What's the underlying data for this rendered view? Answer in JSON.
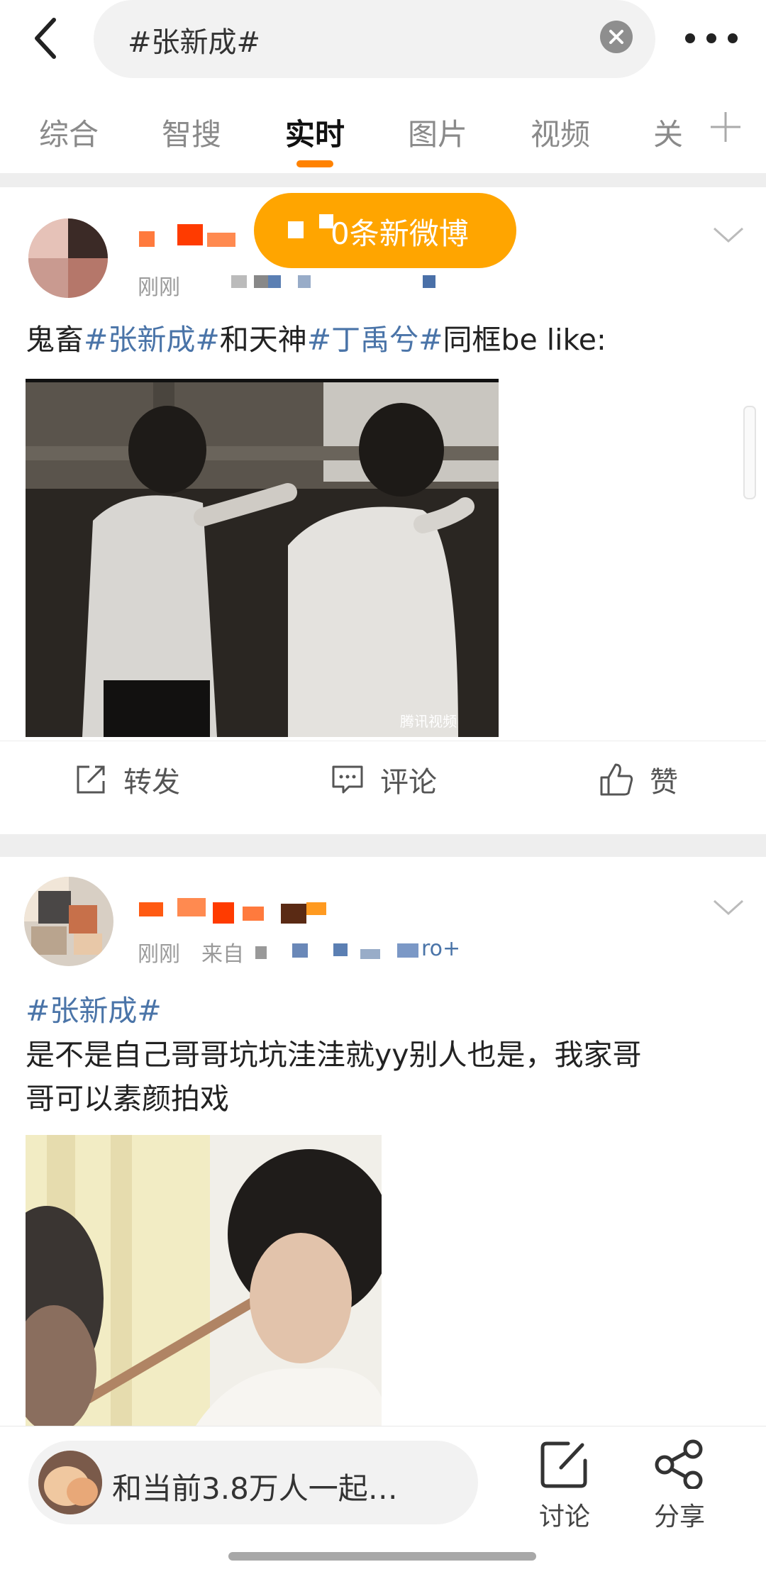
{
  "search": {
    "query": "#张新成#"
  },
  "tabs": [
    {
      "label": "综合",
      "active": false
    },
    {
      "label": "智搜",
      "active": false
    },
    {
      "label": "实时",
      "active": true
    },
    {
      "label": "图片",
      "active": false
    },
    {
      "label": "视频",
      "active": false
    },
    {
      "label": "关",
      "active": false
    }
  ],
  "toast": {
    "text": "0条新微博"
  },
  "post1": {
    "time": "刚刚",
    "text_pre": "鬼畜",
    "topic1": "#张新成#",
    "text_mid": "和天神",
    "topic2": "#丁禹兮#",
    "text_post": "同框be like:",
    "image_watermark": "腾讯视频"
  },
  "actions": {
    "repost": "转发",
    "comment": "评论",
    "like": "赞"
  },
  "post2": {
    "time": "刚刚",
    "source_prefix": "来自",
    "source_suffix": "ro+",
    "topic": "#张新成#",
    "text_line1": "是不是自己哥哥坑坑洼洼就yy别人也是，我家哥",
    "text_line2": "哥可以素颜拍戏"
  },
  "bottom": {
    "join_text": "和当前3.8万人一起…",
    "discuss": "讨论",
    "share": "分享"
  },
  "colors": {
    "accent": "#ff8200",
    "topic": "#4a74a8",
    "toast_bg": "#ffa500"
  }
}
